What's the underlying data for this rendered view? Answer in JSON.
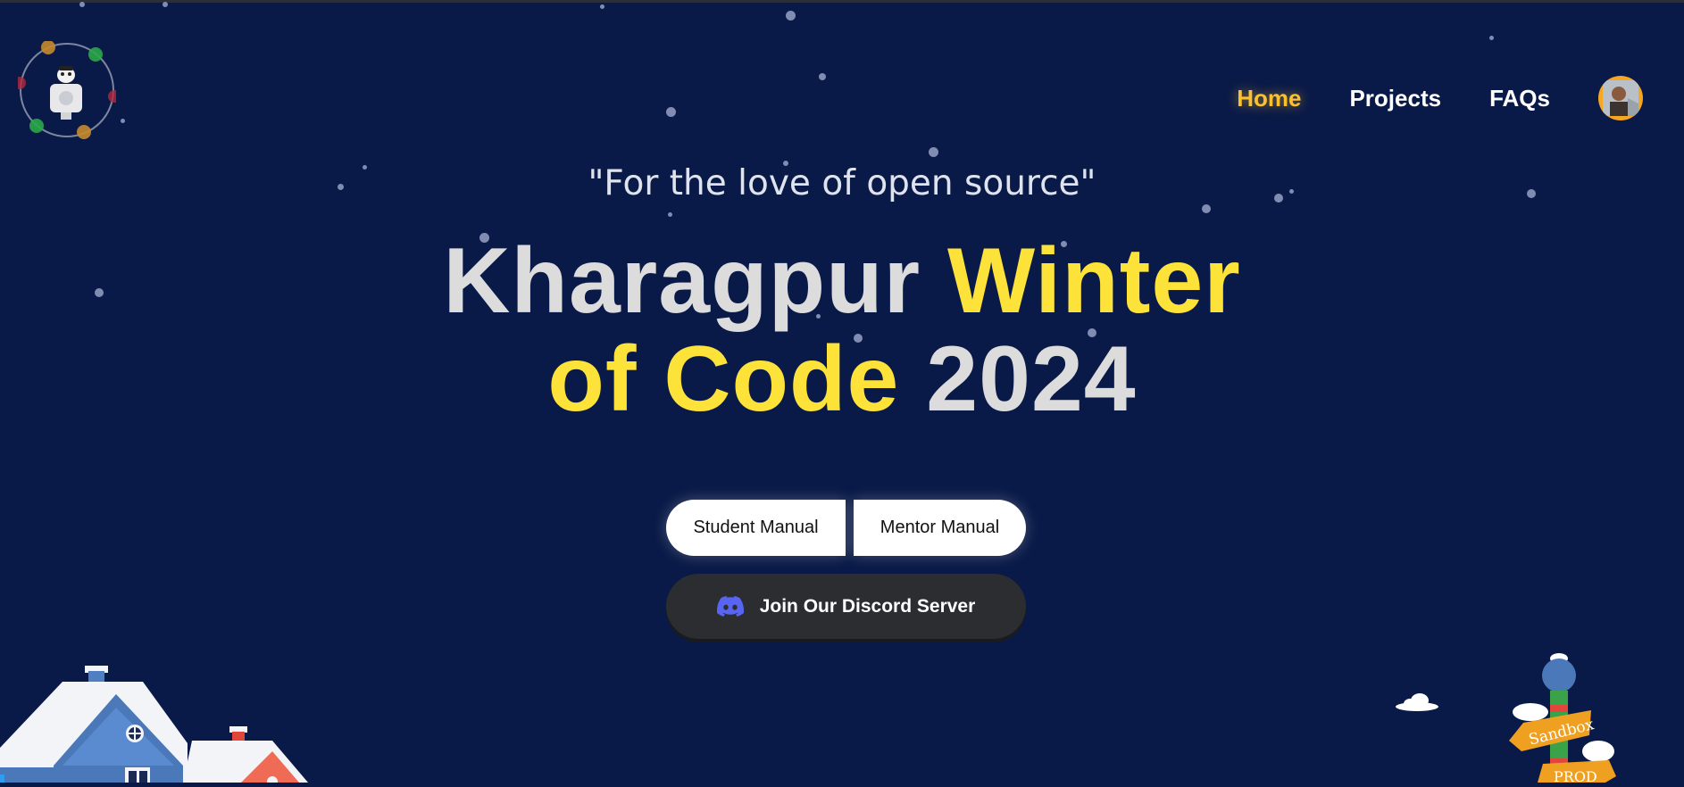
{
  "nav": {
    "items": [
      {
        "label": "Home",
        "active": true
      },
      {
        "label": "Projects",
        "active": false
      },
      {
        "label": "FAQs",
        "active": false
      }
    ],
    "logo_icon": "kwoc-robot-logo-icon",
    "avatar_icon": "user-avatar-icon"
  },
  "hero": {
    "tagline": "\"For the love of open source\"",
    "title": {
      "part1": "Kharagpur ",
      "part2": "Winter",
      "part3": "of Code",
      "part4": " 2024"
    }
  },
  "buttons": {
    "student_manual": "Student Manual",
    "mentor_manual": "Mentor Manual",
    "discord": "Join Our Discord Server"
  },
  "colors": {
    "background": "#0a1a48",
    "accent_yellow": "#fde23a",
    "nav_active": "#fbc02d",
    "discord_blurple": "#5865f2"
  },
  "decorations": {
    "signpost_labels": [
      "Sandbox",
      "PROD"
    ]
  }
}
